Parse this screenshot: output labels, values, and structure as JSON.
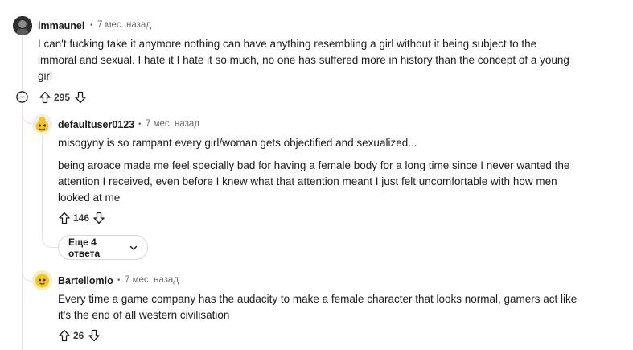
{
  "comments": [
    {
      "author": "immaunel",
      "separator": "•",
      "time": "7 мес. назад",
      "lines": [
        "I can't fucking take it anymore nothing can have anything resembling a girl without it being subject to the",
        "immoral and sexual. I hate it I hate it so much, no one has suffered more in history than the concept of a young",
        "girl"
      ],
      "votes": "295",
      "avatar_icon": "dark-photo-avatar"
    },
    {
      "author": "defaultuser0123",
      "separator": "•",
      "time": "7 мес. назад",
      "para1": "misogyny is so rampant every girl/woman gets objectified and sexualized...",
      "para2_lines": [
        "being aroace made me feel specially bad for having a female body for a long time since I never wanted the",
        "attention I received, even before I knew what that attention meant I just felt uncomfortable with how men",
        "looked at me"
      ],
      "votes": "146",
      "avatar_icon": "yellow-snoo-avatar",
      "more_replies": "Еще 4 ответа"
    },
    {
      "author": "Bartellomio",
      "separator": "•",
      "time": "7 мес. назад",
      "lines": [
        "Every time a game company has the audacity to make a female character that looks normal, gamers act like",
        "it's the end of all western civilisation"
      ],
      "votes": "26",
      "avatar_icon": "yellow-snoo-avatar"
    }
  ],
  "colors": {
    "accent_yellow": "#f5c518",
    "thread_line": "#e2e4e6",
    "text": "#1c1c1c",
    "muted": "#6b6b6b"
  }
}
